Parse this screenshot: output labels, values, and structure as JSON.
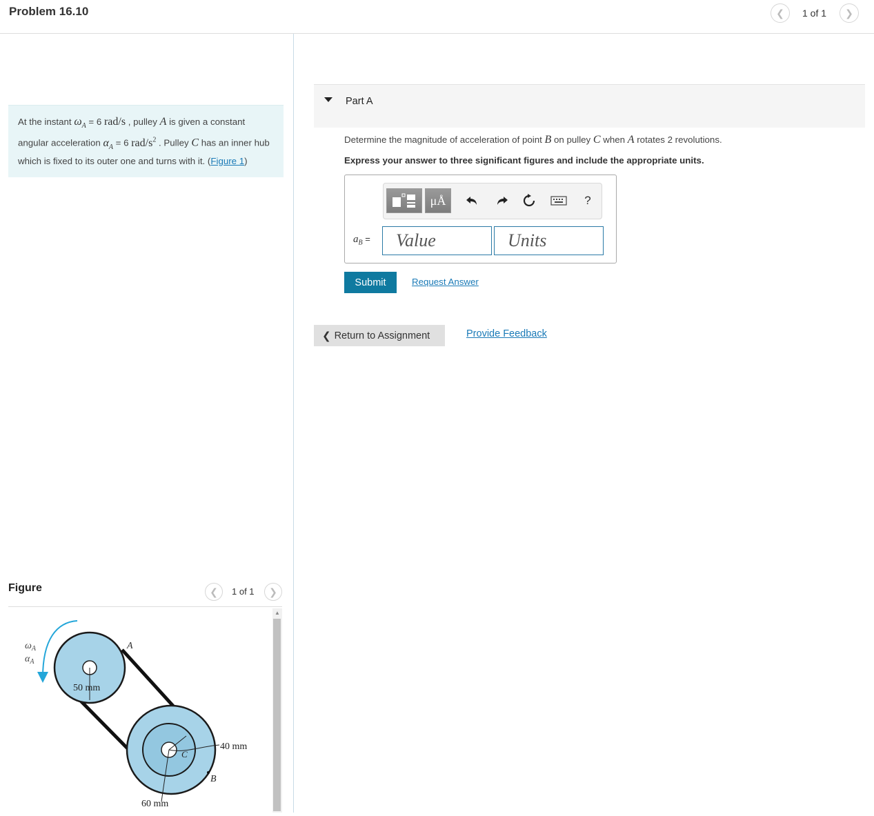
{
  "header": {
    "title": "Problem 16.10",
    "pager": "1 of 1"
  },
  "intro": {
    "t1": "At the instant ",
    "omega_sym": "ω",
    "omega_sub": "A",
    "t2": " = 6 ",
    "unit1": "rad/s",
    "t3": " , pulley ",
    "A": "A",
    "t4": " is given a constant angular acceleration ",
    "alpha_sym": "α",
    "alpha_sub": "A",
    "t5": " = 6 ",
    "unit2_base": "rad/s",
    "unit2_exp": "2",
    "t6": " . Pulley ",
    "C": "C",
    "t7": " has an inner hub which is fixed to its outer one and turns with it. (",
    "figure_link": "Figure 1",
    "t8": ")"
  },
  "figure": {
    "label": "Figure",
    "pager": "1 of 1",
    "labels": {
      "omega": "ω",
      "omega_sub": "A",
      "alpha": "α",
      "alpha_sub": "A",
      "A": "A",
      "B": "B",
      "C": "C",
      "r_a": "50 mm",
      "r_inner": "40 mm",
      "r_outer": "60 mm"
    }
  },
  "part": {
    "title": "Part A",
    "q1": "Determine the magnitude of acceleration of point ",
    "B": "B",
    "q2": " on pulley ",
    "C": "C",
    "q3": " when ",
    "A": "A",
    "q4": " rotates 2 revolutions.",
    "instructions": "Express your answer to three significant figures and include the appropriate units.",
    "var_name": "a",
    "var_sub": "B",
    "var_eq": " =",
    "value_placeholder": "Value",
    "units_placeholder": "Units",
    "unit_btn": "μÅ",
    "help": "?",
    "submit": "Submit",
    "request": "Request Answer"
  },
  "footer": {
    "return": "Return to Assignment",
    "feedback": "Provide Feedback"
  },
  "colors": {
    "accent": "#0f7aa0",
    "link": "#1a7ab7",
    "pulley_fill": "#a7d3e8",
    "arrow": "#23a6d9"
  }
}
